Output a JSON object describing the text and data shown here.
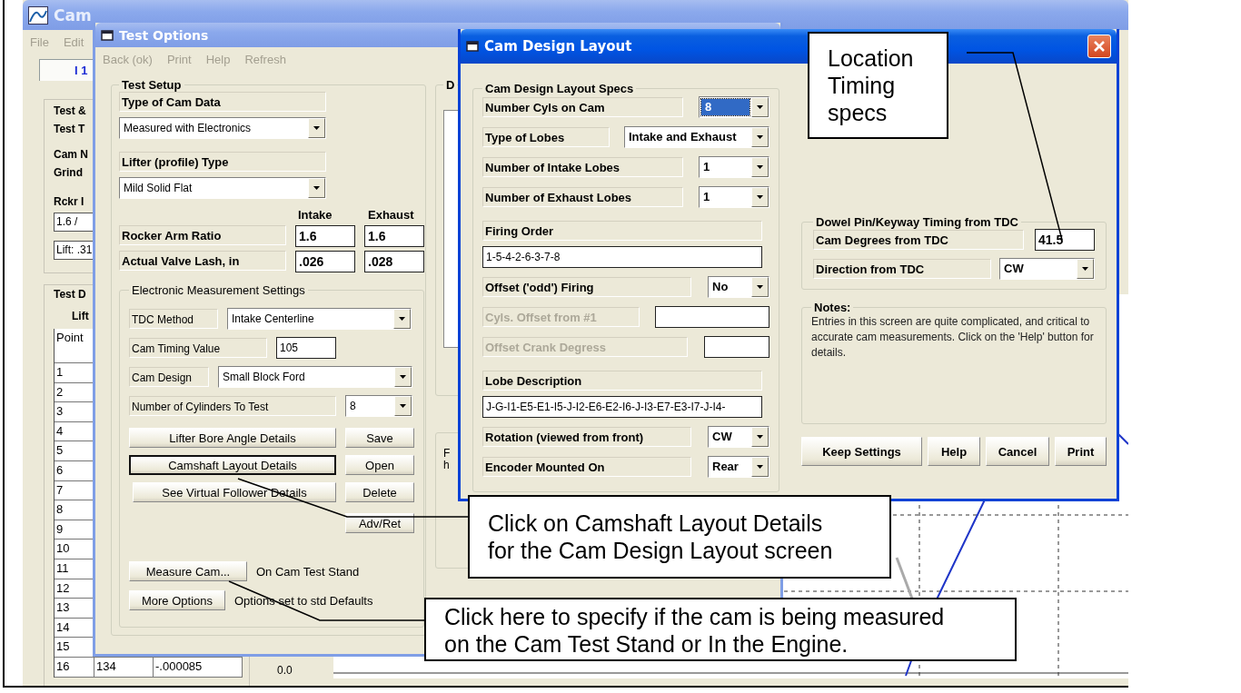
{
  "main_window": {
    "title": "Cam",
    "menu": [
      "File",
      "Edit"
    ],
    "tab": "I 1",
    "info_labels": [
      "Test &",
      "Test T",
      "Cam N",
      "Grind",
      "Rckr I"
    ],
    "fields": [
      "1.6  /",
      "Lift: .31"
    ],
    "data_group": {
      "title": "Test D",
      "subtitle": "Lift",
      "column_header": "Point",
      "rows": [
        {
          "point": "1"
        },
        {
          "point": "2"
        },
        {
          "point": "3"
        },
        {
          "point": "4"
        },
        {
          "point": "5"
        },
        {
          "point": "6"
        },
        {
          "point": "7"
        },
        {
          "point": "8"
        },
        {
          "point": "9"
        },
        {
          "point": "10"
        },
        {
          "point": "11"
        },
        {
          "point": "12"
        },
        {
          "point": "13"
        },
        {
          "point": "14"
        },
        {
          "point": "15"
        },
        {
          "point": "16",
          "column_2": "134",
          "column_3": "-.000085"
        }
      ]
    },
    "chart_tick": "0.0"
  },
  "test_options": {
    "title": "Test Options",
    "menu": [
      {
        "label": "Back (ok)",
        "disabled": true
      },
      {
        "label": "Print",
        "disabled": true
      },
      {
        "label": "Help",
        "disabled": true
      },
      {
        "label": "Refresh",
        "disabled": true
      }
    ],
    "test_setup": {
      "title": "Test Setup",
      "cam_data": {
        "label": "Type of Cam Data",
        "value": "Measured with Electronics"
      },
      "lifter": {
        "label": "Lifter (profile) Type",
        "value": "Mild Solid Flat"
      },
      "columns": [
        "Intake",
        "Exhaust"
      ],
      "ratios": [
        {
          "label": "Rocker Arm Ratio",
          "intake": "1.6",
          "exhaust": "1.6"
        },
        {
          "label": "Actual Valve Lash, in",
          "intake": ".026",
          "exhaust": ".028"
        }
      ],
      "electronic": {
        "title": "Electronic Measurement Settings",
        "tdc_method": {
          "label": "TDC Method",
          "value": "Intake Centerline"
        },
        "cam_timing": {
          "label": "Cam Timing Value",
          "value": "105"
        },
        "cam_design": {
          "label": "Cam Design",
          "value": "Small Block Ford"
        },
        "cylinders": {
          "label": "Number of Cylinders To Test",
          "value": "8"
        },
        "detail_buttons": [
          {
            "label": "Lifter Bore Angle Details",
            "focused": false
          },
          {
            "label": "Camshaft Layout Details",
            "focused": true
          },
          {
            "label": "See Virtual Follower Details",
            "focused": false
          }
        ],
        "file_buttons": [
          "Save",
          "Open",
          "Delete",
          "Adv/Ret"
        ],
        "status_rows": [
          {
            "button": "Measure Cam...",
            "status": "On Cam Test Stand"
          },
          {
            "button": "More Options",
            "status": "Options set to std Defaults"
          }
        ]
      }
    },
    "right_group_title": "D",
    "right_text": [
      "F",
      "h"
    ]
  },
  "cam_design_layout": {
    "title": "Cam Design Layout",
    "specs": {
      "title": "Cam Design Layout Specs",
      "rows": [
        {
          "kind": "dropdown",
          "label": "Number Cyls on Cam",
          "value": "8",
          "disabled": false,
          "focused": true
        },
        {
          "kind": "dropdown",
          "label": "Type of Lobes",
          "value": "Intake and Exhaust",
          "disabled": false,
          "focused": false
        },
        {
          "kind": "dropdown",
          "label": "Number of Intake Lobes",
          "value": "1",
          "disabled": false,
          "focused": false
        },
        {
          "kind": "dropdown",
          "label": "Number of Exhaust Lobes",
          "value": "1",
          "disabled": false,
          "focused": false
        },
        {
          "kind": "stacked",
          "label": "Firing Order",
          "value": "1-5-4-2-6-3-7-8",
          "disabled": false,
          "focused": false
        },
        {
          "kind": "dropdown",
          "label": "Offset ('odd') Firing",
          "value": "No",
          "disabled": false,
          "focused": false
        },
        {
          "kind": "field",
          "label": "Cyls. Offset from #1",
          "disabled": true,
          "focused": false
        },
        {
          "kind": "field",
          "label": "Offset Crank Degress",
          "disabled": true,
          "focused": false
        },
        {
          "kind": "stacked",
          "label": "Lobe Description",
          "value": "J-G-I1-E5-E1-I5-J-I2-E6-E2-I6-J-I3-E7-E3-I7-J-I4-",
          "disabled": false,
          "focused": false
        },
        {
          "kind": "dropdown",
          "label": "Rotation (viewed from front)",
          "value": "CW",
          "disabled": false,
          "focused": false
        },
        {
          "kind": "dropdown",
          "label": "Encoder Mounted On",
          "value": "Rear",
          "disabled": false,
          "focused": false
        }
      ]
    },
    "dowel": {
      "title": "Dowel Pin/Keyway Timing from TDC",
      "rows": [
        {
          "kind": "field",
          "label": "Cam Degrees from TDC",
          "value": "41.5"
        },
        {
          "kind": "dropdown",
          "label": "Direction from TDC",
          "value": "CW"
        }
      ]
    },
    "notes": {
      "title": "Notes:",
      "text": "Entries in this screen are quite complicated, and critical to accurate cam measurements.  Click on the 'Help' button for details."
    },
    "buttons": [
      "Keep Settings",
      "Help",
      "Cancel",
      "Print"
    ]
  },
  "callouts": [
    {
      "text": "Location Timing specs"
    },
    {
      "text": "Click on Camshaft Layout Details for the Cam Design Layout screen"
    },
    {
      "text": "Click here to specify if the cam is being measured on the Cam Test Stand or In the Engine."
    }
  ]
}
